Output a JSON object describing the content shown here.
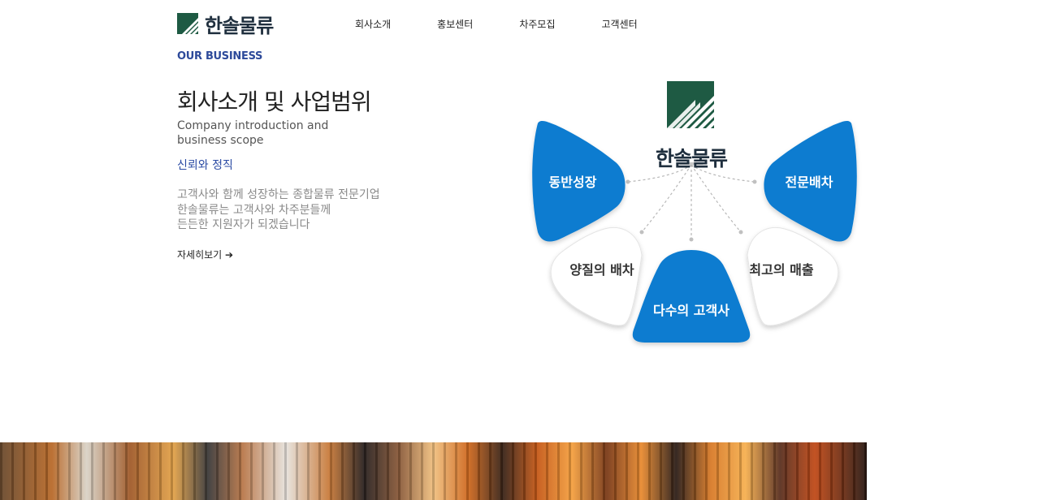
{
  "header": {
    "logo_text": "한솔물류",
    "nav": [
      "회사소개",
      "홍보센터",
      "차주모집",
      "고객센터"
    ]
  },
  "intro": {
    "eyebrow": "OUR BUSINESS",
    "headline": "회사소개 및 사업범위",
    "subtitle_en": [
      "Company introduction and",
      "business scope"
    ],
    "tagline": "신뢰와 정직",
    "description": [
      "고객사와 함께 성장하는 종합물류 전문기업",
      "한솔물류는 고객사와 차주분들께",
      "든든한 지원자가 되겠습니다"
    ],
    "more_link": "자세히보기 ➔"
  },
  "diagram": {
    "center_name": "한솔물류",
    "petals": {
      "top_left": "동반성장",
      "top_right": "전문배차",
      "mid_left": "양질의 배차",
      "mid_right": "최고의 매출",
      "bottom": "다수의 고객사"
    },
    "colors": {
      "accent": "#0a7bd0",
      "logo_green": "#1e5a43",
      "dark_text": "#1f2f3e"
    }
  }
}
